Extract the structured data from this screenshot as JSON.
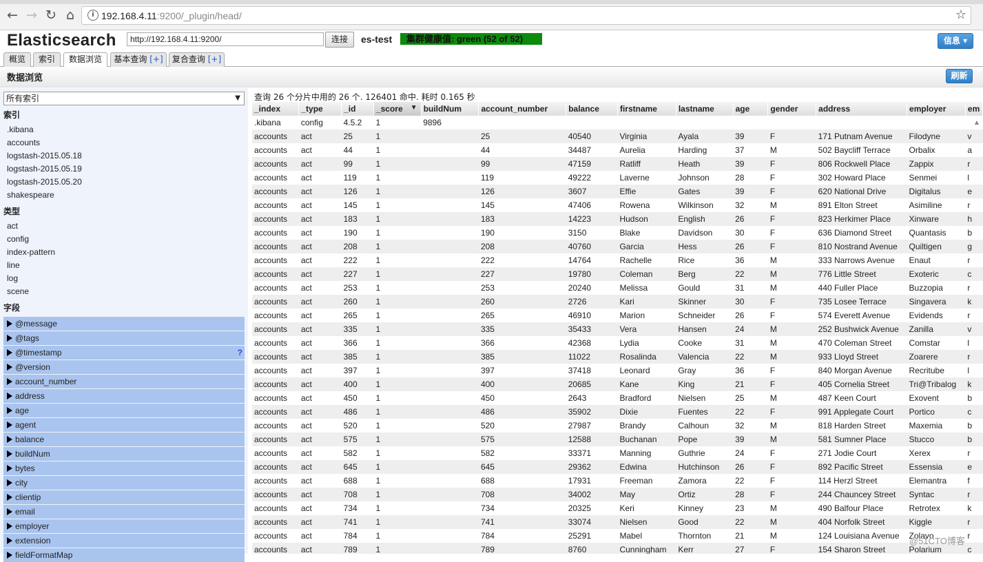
{
  "browser": {
    "url_host": "192.168.4.11",
    "url_rest": ":9200/_plugin/head/"
  },
  "app": {
    "title": "Elasticsearch",
    "connect_url": "http://192.168.4.11:9200/",
    "connect_label": "连接",
    "cluster_name": "es-test",
    "health": "集群健康值: green (52 of 52)",
    "health_color": "#0d8a0d",
    "info_label": "信息 ▾"
  },
  "tabs": [
    {
      "label": "概览"
    },
    {
      "label": "索引"
    },
    {
      "label": "数据浏览"
    },
    {
      "label": "基本查询",
      "plus": "[+]"
    },
    {
      "label": "复合查询",
      "plus": "[+]"
    }
  ],
  "page": {
    "title": "数据浏览",
    "refresh_label": "刷新"
  },
  "sidebar": {
    "index_select": "所有索引",
    "indices_header": "索引",
    "indices": [
      ".kibana",
      "accounts",
      "logstash-2015.05.18",
      "logstash-2015.05.19",
      "logstash-2015.05.20",
      "shakespeare"
    ],
    "types_header": "类型",
    "types": [
      "act",
      "config",
      "index-pattern",
      "line",
      "log",
      "scene"
    ],
    "fields_header": "字段",
    "fields": [
      "@message",
      "@tags",
      "@timestamp",
      "@version",
      "account_number",
      "address",
      "age",
      "agent",
      "balance",
      "buildNum",
      "bytes",
      "city",
      "clientip",
      "email",
      "employer",
      "extension",
      "fieldFormatMap"
    ],
    "help": "?"
  },
  "results": {
    "summary": "查询 26 个分片中用的 26 个. 126401 命中. 耗时 0.165 秒",
    "columns": [
      "_index",
      "_type",
      "_id",
      "_score",
      "buildNum",
      "account_number",
      "balance",
      "firstname",
      "lastname",
      "age",
      "gender",
      "address",
      "employer",
      "em"
    ],
    "sort_indicator": "▼",
    "rows": [
      [
        ".kibana",
        "config",
        "4.5.2",
        "1",
        "9896",
        "",
        "",
        "",
        "",
        "",
        "",
        "",
        "",
        ""
      ],
      [
        "accounts",
        "act",
        "25",
        "1",
        "",
        "25",
        "40540",
        "Virginia",
        "Ayala",
        "39",
        "F",
        "171 Putnam Avenue",
        "Filodyne",
        "v"
      ],
      [
        "accounts",
        "act",
        "44",
        "1",
        "",
        "44",
        "34487",
        "Aurelia",
        "Harding",
        "37",
        "M",
        "502 Baycliff Terrace",
        "Orbalix",
        "a"
      ],
      [
        "accounts",
        "act",
        "99",
        "1",
        "",
        "99",
        "47159",
        "Ratliff",
        "Heath",
        "39",
        "F",
        "806 Rockwell Place",
        "Zappix",
        "r"
      ],
      [
        "accounts",
        "act",
        "119",
        "1",
        "",
        "119",
        "49222",
        "Laverne",
        "Johnson",
        "28",
        "F",
        "302 Howard Place",
        "Senmei",
        "l"
      ],
      [
        "accounts",
        "act",
        "126",
        "1",
        "",
        "126",
        "3607",
        "Effie",
        "Gates",
        "39",
        "F",
        "620 National Drive",
        "Digitalus",
        "e"
      ],
      [
        "accounts",
        "act",
        "145",
        "1",
        "",
        "145",
        "47406",
        "Rowena",
        "Wilkinson",
        "32",
        "M",
        "891 Elton Street",
        "Asimiline",
        "r"
      ],
      [
        "accounts",
        "act",
        "183",
        "1",
        "",
        "183",
        "14223",
        "Hudson",
        "English",
        "26",
        "F",
        "823 Herkimer Place",
        "Xinware",
        "h"
      ],
      [
        "accounts",
        "act",
        "190",
        "1",
        "",
        "190",
        "3150",
        "Blake",
        "Davidson",
        "30",
        "F",
        "636 Diamond Street",
        "Quantasis",
        "b"
      ],
      [
        "accounts",
        "act",
        "208",
        "1",
        "",
        "208",
        "40760",
        "Garcia",
        "Hess",
        "26",
        "F",
        "810 Nostrand Avenue",
        "Quiltigen",
        "g"
      ],
      [
        "accounts",
        "act",
        "222",
        "1",
        "",
        "222",
        "14764",
        "Rachelle",
        "Rice",
        "36",
        "M",
        "333 Narrows Avenue",
        "Enaut",
        "r"
      ],
      [
        "accounts",
        "act",
        "227",
        "1",
        "",
        "227",
        "19780",
        "Coleman",
        "Berg",
        "22",
        "M",
        "776 Little Street",
        "Exoteric",
        "c"
      ],
      [
        "accounts",
        "act",
        "253",
        "1",
        "",
        "253",
        "20240",
        "Melissa",
        "Gould",
        "31",
        "M",
        "440 Fuller Place",
        "Buzzopia",
        "r"
      ],
      [
        "accounts",
        "act",
        "260",
        "1",
        "",
        "260",
        "2726",
        "Kari",
        "Skinner",
        "30",
        "F",
        "735 Losee Terrace",
        "Singavera",
        "k"
      ],
      [
        "accounts",
        "act",
        "265",
        "1",
        "",
        "265",
        "46910",
        "Marion",
        "Schneider",
        "26",
        "F",
        "574 Everett Avenue",
        "Evidends",
        "r"
      ],
      [
        "accounts",
        "act",
        "335",
        "1",
        "",
        "335",
        "35433",
        "Vera",
        "Hansen",
        "24",
        "M",
        "252 Bushwick Avenue",
        "Zanilla",
        "v"
      ],
      [
        "accounts",
        "act",
        "366",
        "1",
        "",
        "366",
        "42368",
        "Lydia",
        "Cooke",
        "31",
        "M",
        "470 Coleman Street",
        "Comstar",
        "l"
      ],
      [
        "accounts",
        "act",
        "385",
        "1",
        "",
        "385",
        "11022",
        "Rosalinda",
        "Valencia",
        "22",
        "M",
        "933 Lloyd Street",
        "Zoarere",
        "r"
      ],
      [
        "accounts",
        "act",
        "397",
        "1",
        "",
        "397",
        "37418",
        "Leonard",
        "Gray",
        "36",
        "F",
        "840 Morgan Avenue",
        "Recritube",
        "l"
      ],
      [
        "accounts",
        "act",
        "400",
        "1",
        "",
        "400",
        "20685",
        "Kane",
        "King",
        "21",
        "F",
        "405 Cornelia Street",
        "Tri@Tribalog",
        "k"
      ],
      [
        "accounts",
        "act",
        "450",
        "1",
        "",
        "450",
        "2643",
        "Bradford",
        "Nielsen",
        "25",
        "M",
        "487 Keen Court",
        "Exovent",
        "b"
      ],
      [
        "accounts",
        "act",
        "486",
        "1",
        "",
        "486",
        "35902",
        "Dixie",
        "Fuentes",
        "22",
        "F",
        "991 Applegate Court",
        "Portico",
        "c"
      ],
      [
        "accounts",
        "act",
        "520",
        "1",
        "",
        "520",
        "27987",
        "Brandy",
        "Calhoun",
        "32",
        "M",
        "818 Harden Street",
        "Maxemia",
        "b"
      ],
      [
        "accounts",
        "act",
        "575",
        "1",
        "",
        "575",
        "12588",
        "Buchanan",
        "Pope",
        "39",
        "M",
        "581 Sumner Place",
        "Stucco",
        "b"
      ],
      [
        "accounts",
        "act",
        "582",
        "1",
        "",
        "582",
        "33371",
        "Manning",
        "Guthrie",
        "24",
        "F",
        "271 Jodie Court",
        "Xerex",
        "r"
      ],
      [
        "accounts",
        "act",
        "645",
        "1",
        "",
        "645",
        "29362",
        "Edwina",
        "Hutchinson",
        "26",
        "F",
        "892 Pacific Street",
        "Essensia",
        "e"
      ],
      [
        "accounts",
        "act",
        "688",
        "1",
        "",
        "688",
        "17931",
        "Freeman",
        "Zamora",
        "22",
        "F",
        "114 Herzl Street",
        "Elemantra",
        "f"
      ],
      [
        "accounts",
        "act",
        "708",
        "1",
        "",
        "708",
        "34002",
        "May",
        "Ortiz",
        "28",
        "F",
        "244 Chauncey Street",
        "Syntac",
        "r"
      ],
      [
        "accounts",
        "act",
        "734",
        "1",
        "",
        "734",
        "20325",
        "Keri",
        "Kinney",
        "23",
        "M",
        "490 Balfour Place",
        "Retrotex",
        "k"
      ],
      [
        "accounts",
        "act",
        "741",
        "1",
        "",
        "741",
        "33074",
        "Nielsen",
        "Good",
        "22",
        "M",
        "404 Norfolk Street",
        "Kiggle",
        "r"
      ],
      [
        "accounts",
        "act",
        "784",
        "1",
        "",
        "784",
        "25291",
        "Mabel",
        "Thornton",
        "21",
        "M",
        "124 Louisiana Avenue",
        "Zolavo",
        "r"
      ],
      [
        "accounts",
        "act",
        "789",
        "1",
        "",
        "789",
        "8760",
        "Cunningham",
        "Kerr",
        "27",
        "F",
        "154 Sharon Street",
        "Polarium",
        "c"
      ]
    ]
  },
  "watermark": "@51CTO博客"
}
